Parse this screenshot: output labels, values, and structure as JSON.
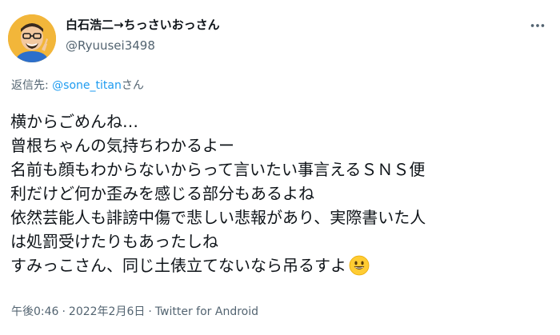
{
  "tweet": {
    "display_name": "白石浩二→ちっさいおっさん",
    "handle": "@Ryuusei3498",
    "reply_prefix": "返信先: ",
    "reply_mention": "@sone_titan",
    "reply_suffix": "さん",
    "body_lines": [
      "横からごめんね…",
      "曾根ちゃんの気持ちわかるよー",
      "名前も顔もわからないからって言いたい事言えるＳＮＳ便",
      "利だけど何か歪みを感じる部分もあるよね",
      "依然芸能人も誹謗中傷で悲しい悲報があり、実際書いた人",
      "は処罰受けたりもあったしね",
      "すみっこさん、同じ土俵立てないなら吊るすよ"
    ],
    "time": "午後0:46",
    "separator": "·",
    "date": "2022年2月6日",
    "source": "Twitter for Android"
  },
  "icons": {
    "avatar": "cartoon-avatar",
    "more": "more-icon",
    "emoji": "grinning-face-emoji"
  },
  "colors": {
    "text": "#0f1419",
    "secondary": "#536471",
    "link": "#1d9bf0",
    "background": "#ffffff"
  }
}
